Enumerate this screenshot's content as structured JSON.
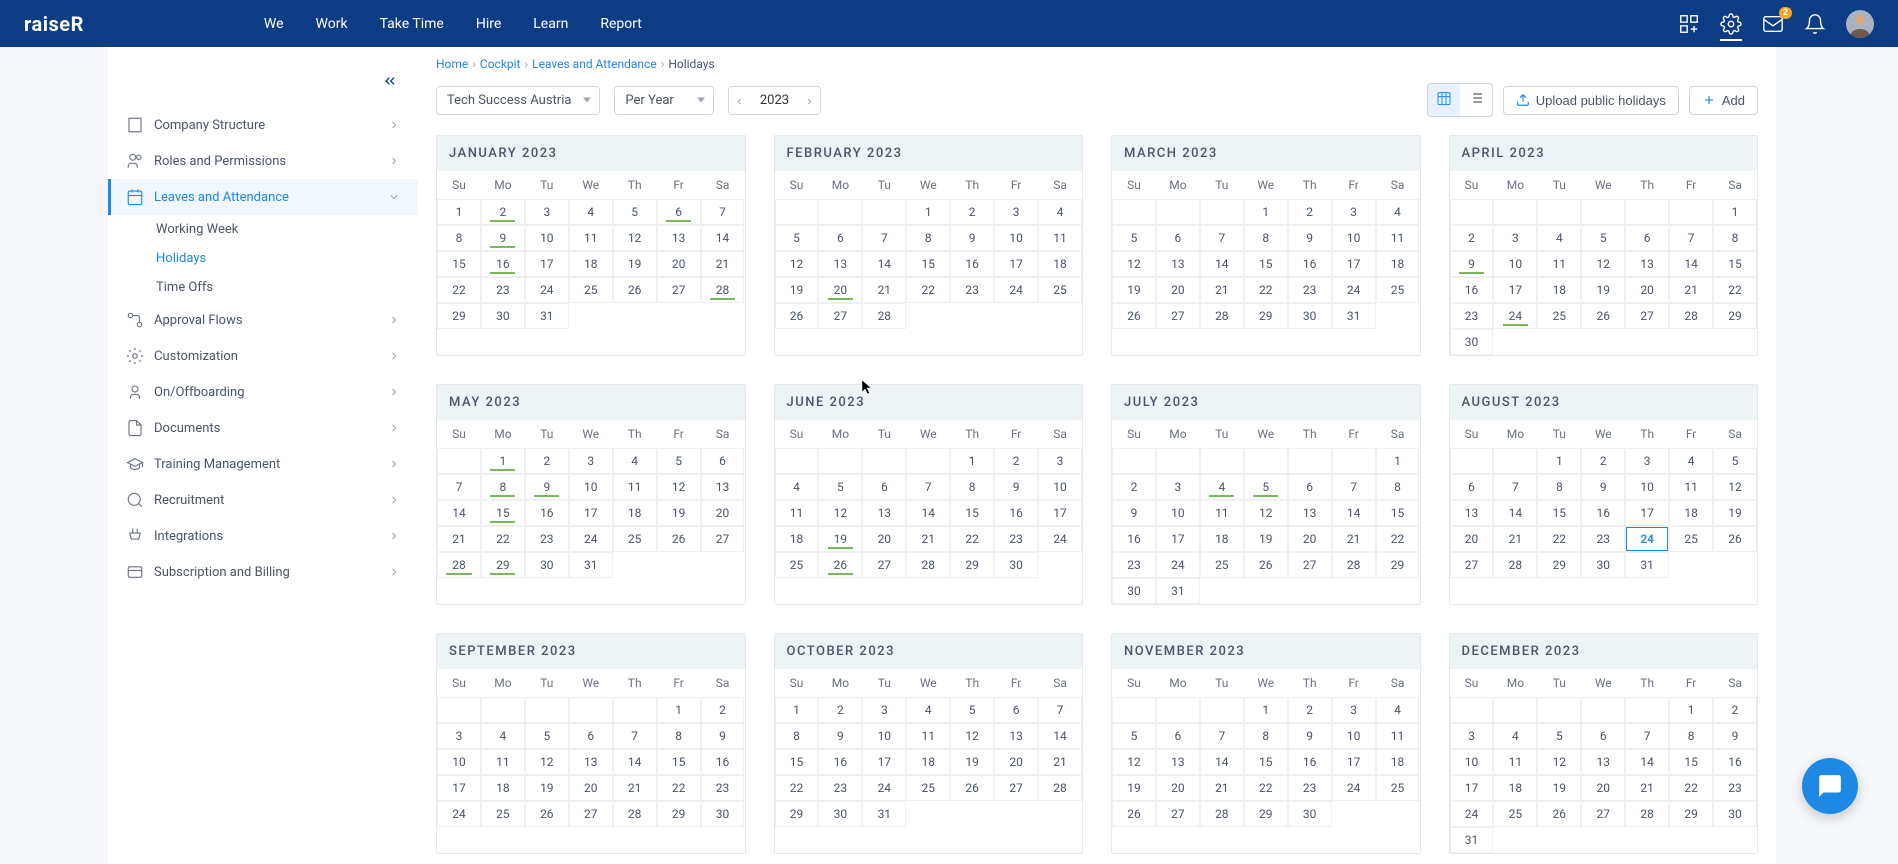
{
  "brand": "raiseR",
  "nav": [
    "We",
    "Work",
    "Take Time",
    "Hire",
    "Learn",
    "Report"
  ],
  "notif_badge": "2",
  "breadcrumbs": [
    "Home",
    "Cockpit",
    "Leaves and Attendance",
    "Holidays"
  ],
  "filters": {
    "company": "Tech Success Austria",
    "period": "Per Year",
    "year": "2023"
  },
  "buttons": {
    "upload": "Upload public holidays",
    "add": "Add"
  },
  "sidebar": [
    {
      "label": "Company Structure",
      "icon": "building"
    },
    {
      "label": "Roles and Permissions",
      "icon": "users"
    },
    {
      "label": "Leaves and Attendance",
      "icon": "calendar",
      "active": true,
      "children": [
        {
          "label": "Working Week"
        },
        {
          "label": "Holidays",
          "sel": true
        },
        {
          "label": "Time Offs"
        }
      ]
    },
    {
      "label": "Approval Flows",
      "icon": "flow"
    },
    {
      "label": "Customization",
      "icon": "gear"
    },
    {
      "label": "On/Offboarding",
      "icon": "board"
    },
    {
      "label": "Documents",
      "icon": "doc"
    },
    {
      "label": "Training Management",
      "icon": "train"
    },
    {
      "label": "Recruitment",
      "icon": "recruit"
    },
    {
      "label": "Integrations",
      "icon": "plug"
    },
    {
      "label": "Subscription and Billing",
      "icon": "bill"
    }
  ],
  "weekdays": [
    "Su",
    "Mo",
    "Tu",
    "We",
    "Th",
    "Fr",
    "Sa"
  ],
  "months": [
    {
      "name": "JANUARY 2023",
      "start": 0,
      "days": 31,
      "hl": [
        2,
        6,
        9,
        16,
        28
      ]
    },
    {
      "name": "FEBRUARY 2023",
      "start": 3,
      "days": 28,
      "hl": [
        20
      ]
    },
    {
      "name": "MARCH 2023",
      "start": 3,
      "days": 31,
      "hl": []
    },
    {
      "name": "APRIL 2023",
      "start": 6,
      "days": 30,
      "hl": [
        9,
        24
      ]
    },
    {
      "name": "MAY 2023",
      "start": 1,
      "days": 31,
      "hl": [
        1,
        8,
        9,
        15,
        28,
        29
      ]
    },
    {
      "name": "JUNE 2023",
      "start": 4,
      "days": 30,
      "hl": [
        19,
        26
      ]
    },
    {
      "name": "JULY 2023",
      "start": 6,
      "days": 31,
      "hl": [
        4,
        5
      ]
    },
    {
      "name": "AUGUST 2023",
      "start": 2,
      "days": 31,
      "hl": [],
      "today": 24
    },
    {
      "name": "SEPTEMBER 2023",
      "start": 5,
      "days": 30,
      "hl": []
    },
    {
      "name": "OCTOBER 2023",
      "start": 0,
      "days": 31,
      "hl": []
    },
    {
      "name": "NOVEMBER 2023",
      "start": 3,
      "days": 30,
      "hl": []
    },
    {
      "name": "DECEMBER 2023",
      "start": 5,
      "days": 31,
      "hl": []
    }
  ]
}
